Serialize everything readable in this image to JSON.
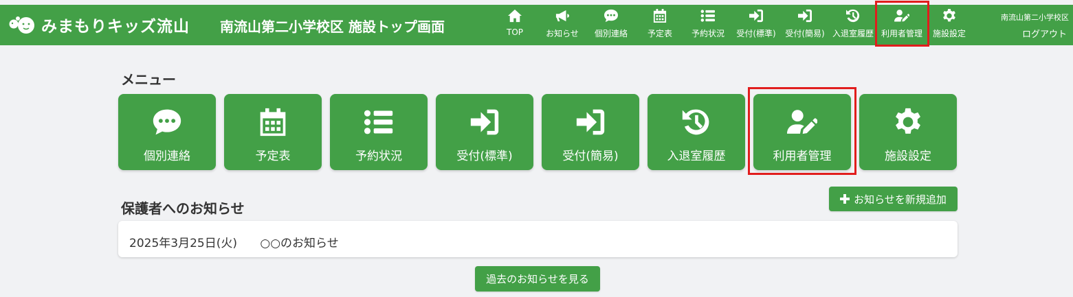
{
  "header": {
    "logo_text": "みまもりキッズ流山",
    "page_title": "南流山第二小学校区 施設トップ画面",
    "school_name": "南流山第二小学校区",
    "logout_label": "ログアウト",
    "nav": [
      {
        "label": "TOP",
        "icon": "home-icon"
      },
      {
        "label": "お知らせ",
        "icon": "megaphone-icon"
      },
      {
        "label": "個別連絡",
        "icon": "chat-icon"
      },
      {
        "label": "予定表",
        "icon": "calendar-icon"
      },
      {
        "label": "予約状況",
        "icon": "list-icon"
      },
      {
        "label": "受付(標準)",
        "icon": "sign-in-icon"
      },
      {
        "label": "受付(簡易)",
        "icon": "sign-in-icon"
      },
      {
        "label": "入退室履歴",
        "icon": "history-icon"
      },
      {
        "label": "利用者管理",
        "icon": "user-edit-icon"
      },
      {
        "label": "施設設定",
        "icon": "gear-icon"
      }
    ]
  },
  "menu": {
    "title": "メニュー",
    "items": [
      {
        "label": "個別連絡",
        "icon": "chat-icon"
      },
      {
        "label": "予定表",
        "icon": "calendar-icon"
      },
      {
        "label": "予約状況",
        "icon": "list-icon"
      },
      {
        "label": "受付(標準)",
        "icon": "sign-in-icon"
      },
      {
        "label": "受付(簡易)",
        "icon": "sign-in-icon"
      },
      {
        "label": "入退室履歴",
        "icon": "history-icon"
      },
      {
        "label": "利用者管理",
        "icon": "user-edit-icon"
      },
      {
        "label": "施設設定",
        "icon": "gear-icon"
      }
    ]
  },
  "notices": {
    "title": "保護者へのお知らせ",
    "add_label": "お知らせを新規追加",
    "items": [
      {
        "date": "2025年3月25日(火)",
        "text": "○○のお知らせ"
      }
    ],
    "past_label": "過去のお知らせを見る"
  },
  "colors": {
    "primary": "#43a047",
    "highlight": "#e11d1d",
    "background": "#f1f2f4"
  }
}
